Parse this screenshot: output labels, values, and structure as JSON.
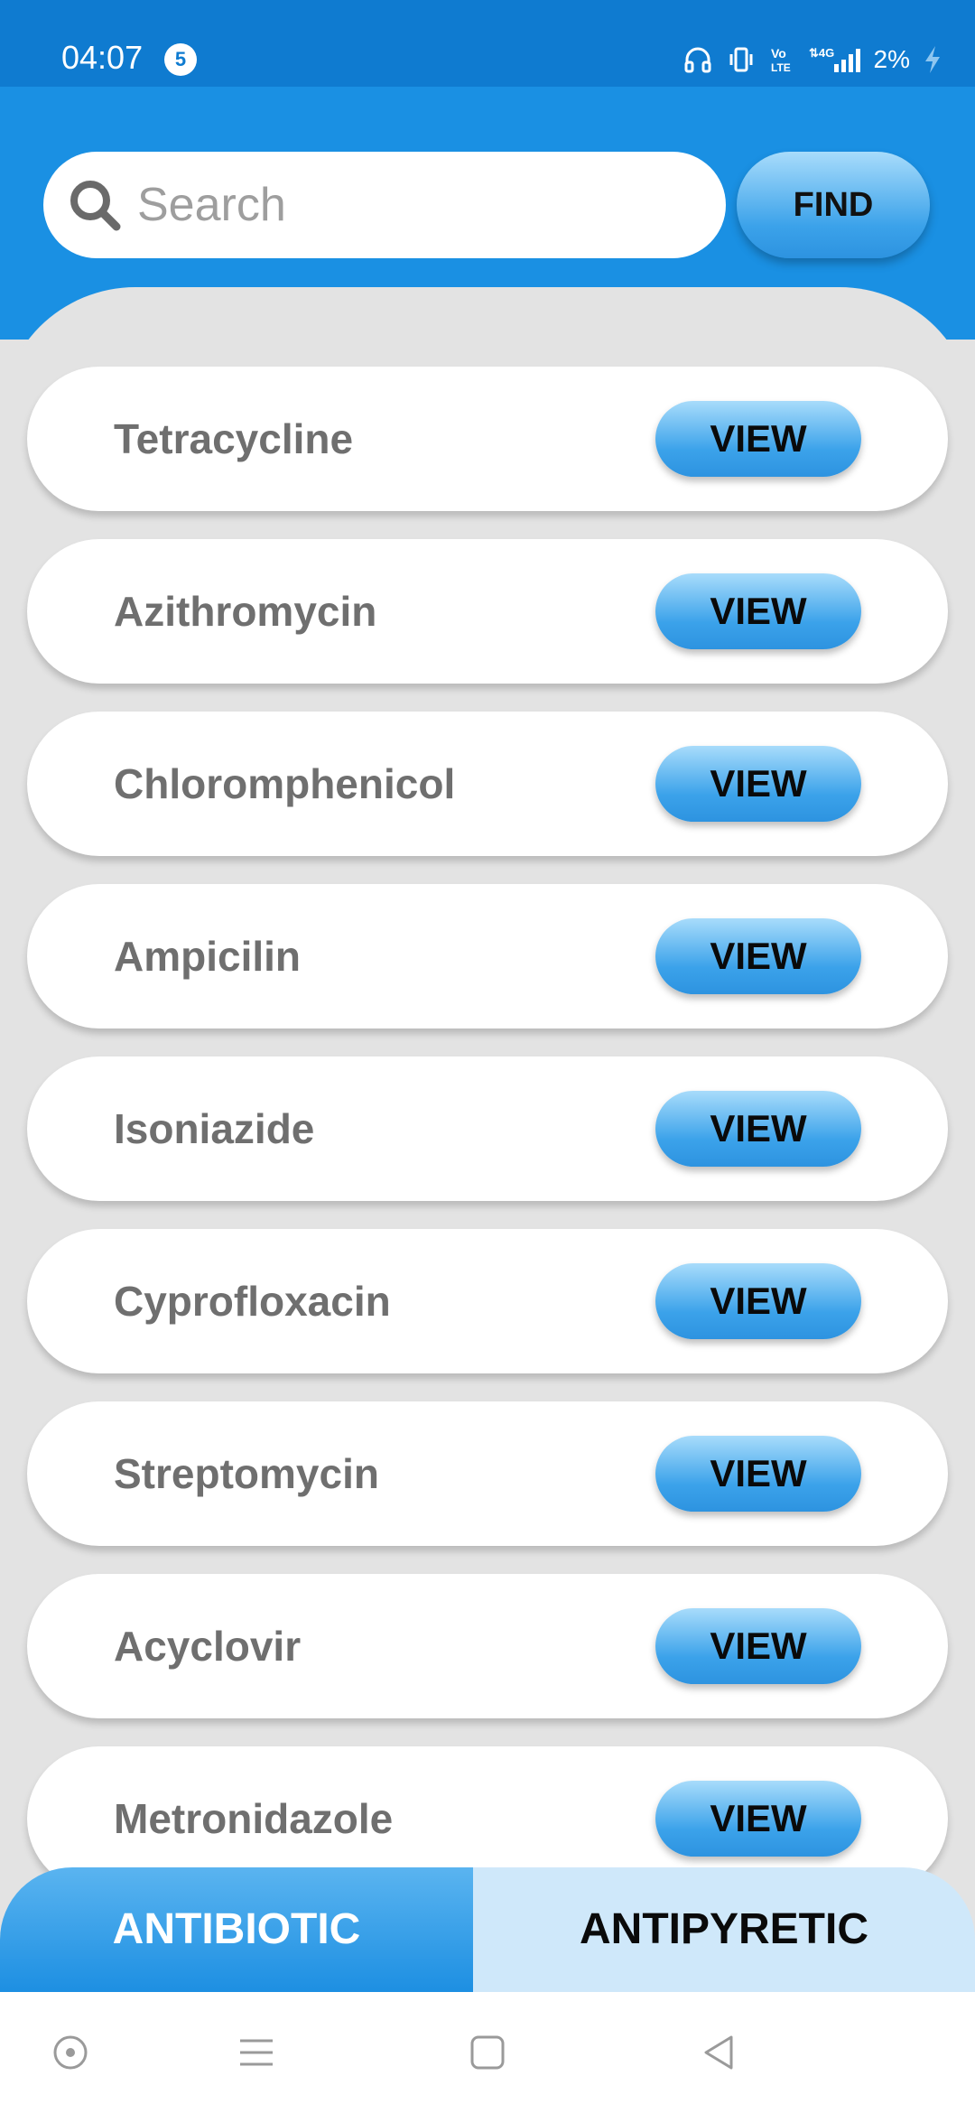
{
  "status_bar": {
    "time": "04:07",
    "notification_count": "5",
    "battery": "2%"
  },
  "search": {
    "placeholder": "Search",
    "find_label": "FIND"
  },
  "medicines": [
    {
      "name": "Tetracycline",
      "action": "VIEW"
    },
    {
      "name": "Azithromycin",
      "action": "VIEW"
    },
    {
      "name": "Chloromphenicol",
      "action": "VIEW"
    },
    {
      "name": "Ampicilin",
      "action": "VIEW"
    },
    {
      "name": "Isoniazide",
      "action": "VIEW"
    },
    {
      "name": "Cyprofloxacin",
      "action": "VIEW"
    },
    {
      "name": "Streptomycin",
      "action": "VIEW"
    },
    {
      "name": "Acyclovir",
      "action": "VIEW"
    },
    {
      "name": "Metronidazole",
      "action": "VIEW"
    }
  ],
  "tabs": {
    "antibiotic": "ANTIBIOTIC",
    "antipyretic": "ANTIPYRETIC",
    "active": "antibiotic"
  },
  "colors": {
    "header": "#1a90e3",
    "status_bar": "#0f7bd0",
    "button_gradient_top": "#a8dcfb",
    "button_gradient_bottom": "#2d93e0",
    "inactive_tab": "#cfe8fa"
  },
  "icons": {
    "status": [
      "headset-icon",
      "vibrate-icon",
      "volte-icon",
      "4g-signal-icon",
      "battery-charging-icon"
    ],
    "nav": [
      "assistant-icon",
      "menu-icon",
      "home-icon",
      "back-icon"
    ]
  }
}
